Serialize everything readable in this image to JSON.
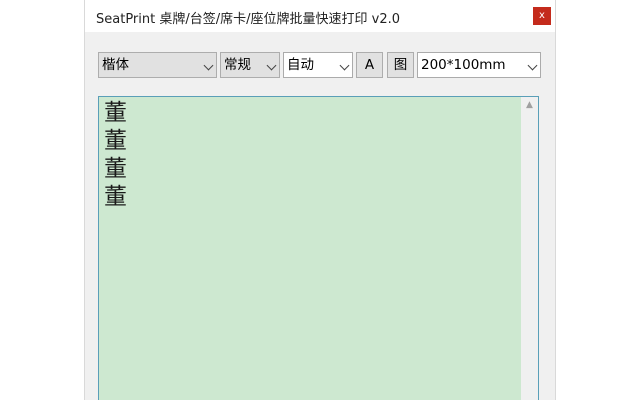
{
  "window": {
    "title": "SeatPrint 桌牌/台签/席卡/座位牌批量快速打印 v2.0",
    "close_label": "x"
  },
  "toolbar": {
    "font_family": "楷体",
    "font_style": "常规",
    "layout_mode": "自动",
    "font_button": "A",
    "image_button": "图",
    "paper_size": "200*100mm"
  },
  "editor": {
    "content": "董\n董\n董\n董",
    "background_color": "#cde8d0"
  },
  "scrollbar": {
    "up_arrow": "▲"
  }
}
